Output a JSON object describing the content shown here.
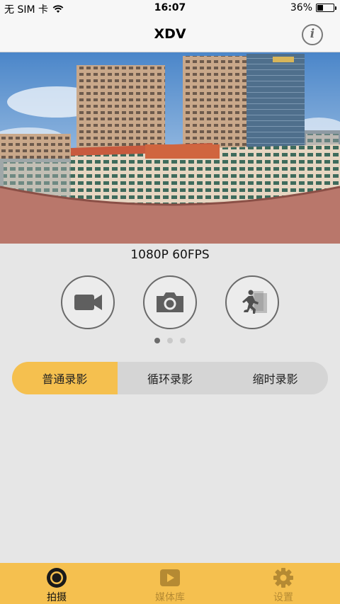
{
  "status_bar": {
    "carrier": "无 SIM 卡",
    "time": "16:07",
    "battery_text": "36%",
    "battery_level": 0.36
  },
  "nav": {
    "title": "XDV",
    "info_glyph": "i"
  },
  "preview": {
    "resolution_label": "1080P 60FPS"
  },
  "modes": [
    {
      "name": "video-camera-icon"
    },
    {
      "name": "camera-icon"
    },
    {
      "name": "running-figure-icon"
    }
  ],
  "pager": {
    "count": 3,
    "active": 0
  },
  "segments": [
    {
      "label": "普通录影",
      "selected": true
    },
    {
      "label": "循环录影",
      "selected": false
    },
    {
      "label": "缩时录影",
      "selected": false
    }
  ],
  "tabs": [
    {
      "label": "拍摄",
      "icon": "lens-icon",
      "active": true
    },
    {
      "label": "媒体库",
      "icon": "play-icon",
      "active": false
    },
    {
      "label": "设置",
      "icon": "gear-icon",
      "active": false
    }
  ],
  "colors": {
    "accent": "#f5c04f",
    "background": "#e6e6e6",
    "segment_bg": "#d5d5d5"
  }
}
